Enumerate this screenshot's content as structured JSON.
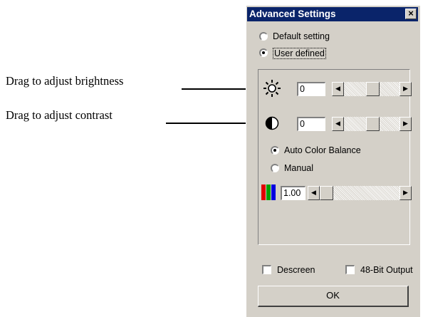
{
  "callouts": {
    "brightness": "Drag to adjust brightness",
    "contrast": "Drag to adjust contrast"
  },
  "dialog": {
    "title": "Advanced Settings",
    "close_icon": "close-icon",
    "mode_options": [
      {
        "label": "Default setting",
        "selected": false
      },
      {
        "label": "User defined",
        "selected": true
      }
    ],
    "brightness": {
      "icon": "sun-icon",
      "value": "0",
      "slider_level": 0.5
    },
    "contrast": {
      "icon": "contrast-icon",
      "value": "0",
      "slider_level": 0.5
    },
    "color_options": [
      {
        "label": "Auto Color Balance",
        "selected": true
      },
      {
        "label": "Manual",
        "selected": false
      }
    ],
    "gamma": {
      "icon": "rgb-bars-icon",
      "value": "1.00",
      "slider_level": 0.1
    },
    "checkboxes": [
      {
        "label": "Descreen",
        "checked": false
      },
      {
        "label": "48-Bit Output",
        "checked": false
      }
    ],
    "ok_label": "OK"
  }
}
